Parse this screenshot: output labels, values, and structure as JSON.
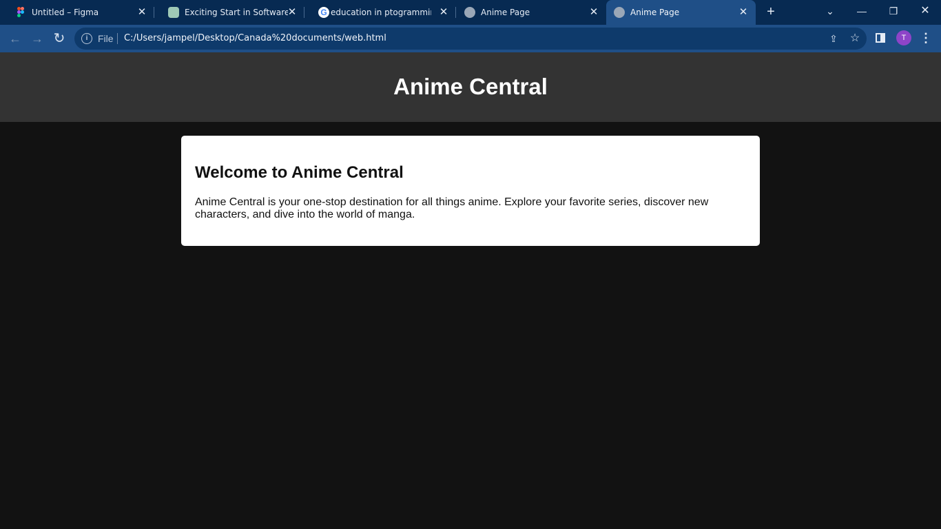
{
  "browser": {
    "tabs": [
      {
        "title": "Untitled – Figma",
        "favicon": "figma-icon",
        "active": false
      },
      {
        "title": "Exciting Start in Software Eng",
        "favicon": "chatgpt-icon",
        "active": false
      },
      {
        "title": "education in ptogramming - ",
        "favicon": "google-icon",
        "active": false
      },
      {
        "title": "Anime Page",
        "favicon": "globe-icon",
        "active": false
      },
      {
        "title": "Anime Page",
        "favicon": "globe-icon",
        "active": true
      }
    ],
    "omnibox": {
      "scheme_label": "File",
      "url": "C:/Users/jampel/Desktop/Canada%20documents/web.html"
    },
    "profile_initial": "T",
    "icons": {
      "back": "←",
      "forward": "→",
      "reload": "↻",
      "close": "✕",
      "new_tab": "+",
      "tab_search": "⌄",
      "minimize": "—",
      "restore": "❐",
      "win_close": "✕",
      "share": "⇪",
      "star": "☆",
      "menu": "⋮",
      "info": "i",
      "google": "G"
    },
    "colors": {
      "tabbar": "#072a52",
      "toolbar": "#1f4f87",
      "omnibox": "#0e3a6b",
      "avatar": "#8e44c8"
    }
  },
  "site": {
    "header_title": "Anime Central",
    "card": {
      "heading": "Welcome to Anime Central",
      "body": "Anime Central is your one-stop destination for all things anime. Explore your favorite series, discover new characters, and dive into the world of manga."
    },
    "colors": {
      "page_bg": "#121212",
      "header_bg": "#333333",
      "card_bg": "#ffffff"
    }
  }
}
